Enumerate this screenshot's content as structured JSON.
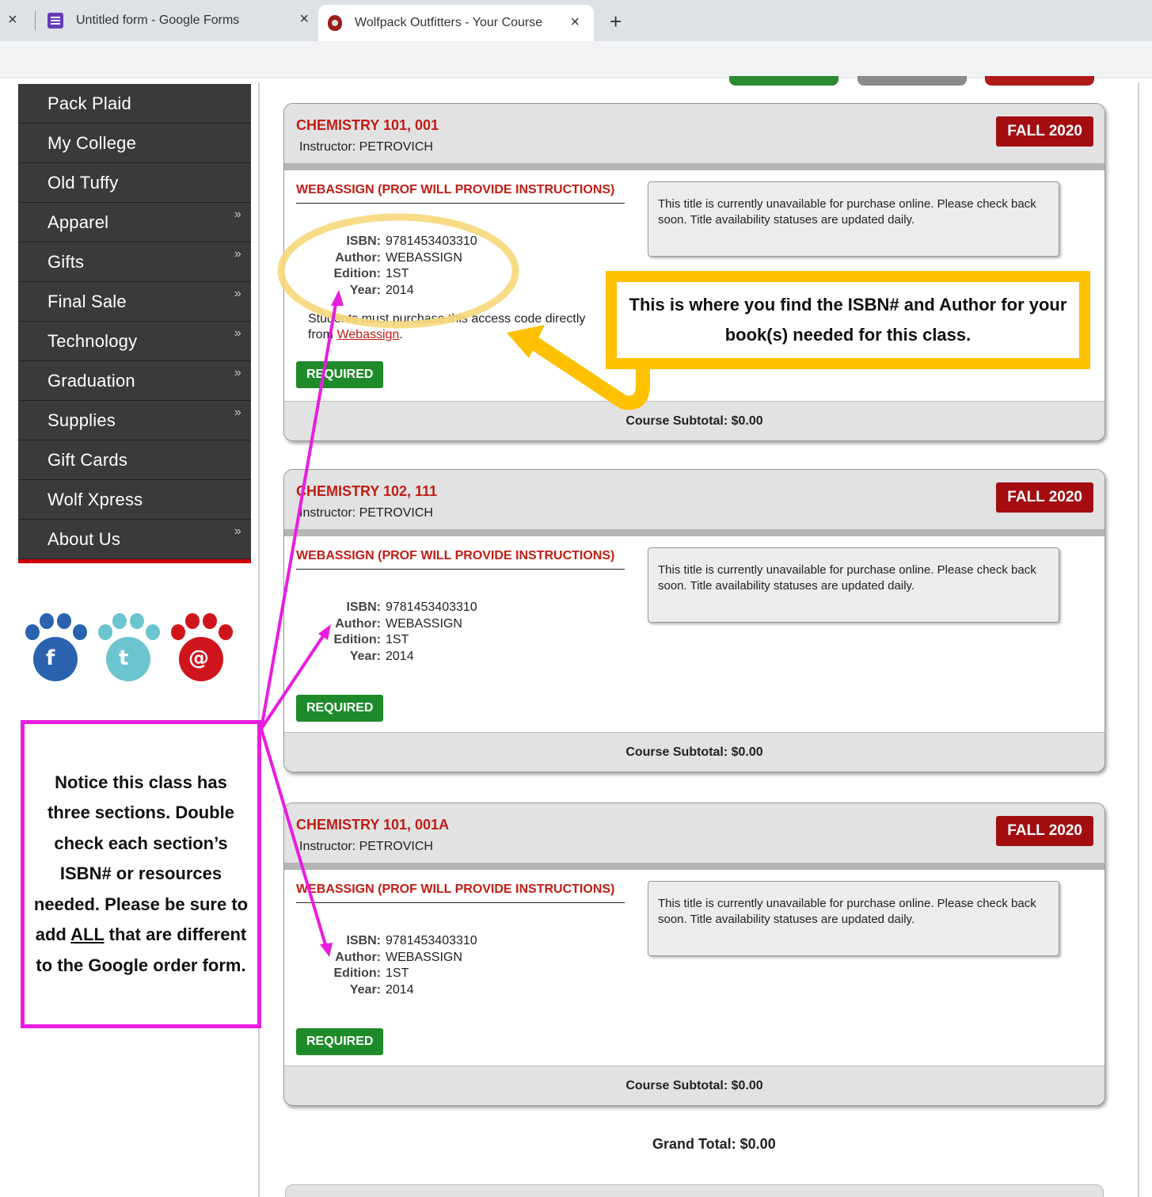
{
  "browser": {
    "tabs": [
      {
        "title": "Untitled form - Google Forms",
        "icon": "google-forms-icon"
      },
      {
        "title": "Wolfpack Outfitters - Your Course",
        "icon": "wolfpack-icon",
        "active": true
      }
    ],
    "new_tab_symbol": "+",
    "close_symbol": "×"
  },
  "sidebar": {
    "items": [
      {
        "label": "Pack Plaid",
        "submenu": false
      },
      {
        "label": "My College",
        "submenu": false
      },
      {
        "label": "Old Tuffy",
        "submenu": false
      },
      {
        "label": "Apparel",
        "submenu": true
      },
      {
        "label": "Gifts",
        "submenu": true
      },
      {
        "label": "Final Sale",
        "submenu": true
      },
      {
        "label": "Technology",
        "submenu": true
      },
      {
        "label": "Graduation",
        "submenu": true
      },
      {
        "label": "Supplies",
        "submenu": true
      },
      {
        "label": "Gift Cards",
        "submenu": false
      },
      {
        "label": "Wolf Xpress",
        "submenu": false
      },
      {
        "label": "About Us",
        "submenu": true
      }
    ],
    "chevron": "»",
    "social": [
      {
        "name": "facebook-paw-icon",
        "letter": "f",
        "color": "#2a62b0"
      },
      {
        "name": "twitter-paw-icon",
        "letter": "t",
        "color": "#6cc4cf"
      },
      {
        "name": "email-paw-icon",
        "letter": "@",
        "color": "#d0141b"
      }
    ]
  },
  "courses": [
    {
      "name": "CHEMISTRY 101, 001",
      "instructor": "Instructor: PETROVICH",
      "term": "FALL 2020",
      "book_title": "WEBASSIGN (PROF WILL PROVIDE INSTRUCTIONS)",
      "isbn_label": "ISBN:",
      "isbn": "9781453403310",
      "author_label": "Author:",
      "author": "WEBASSIGN",
      "edition_label": "Edition:",
      "edition": "1ST",
      "year_label": "Year:",
      "year": "2014",
      "note_text": "Students must purchase this access code directly from ",
      "note_link": "Webassign",
      "note_end": ".",
      "required": "REQUIRED",
      "availability": "This title is currently unavailable for purchase online. Please check back soon. Title availability statuses are updated daily.",
      "subtotal": "Course Subtotal: $0.00"
    },
    {
      "name": "CHEMISTRY 102, 111",
      "instructor": "Instructor: PETROVICH",
      "term": "FALL 2020",
      "book_title": "WEBASSIGN (PROF WILL PROVIDE INSTRUCTIONS)",
      "isbn_label": "ISBN:",
      "isbn": "9781453403310",
      "author_label": "Author:",
      "author": "WEBASSIGN",
      "edition_label": "Edition:",
      "edition": "1ST",
      "year_label": "Year:",
      "year": "2014",
      "required": "REQUIRED",
      "availability": "This title is currently unavailable for purchase online. Please check back soon. Title availability statuses are updated daily.",
      "subtotal": "Course Subtotal: $0.00"
    },
    {
      "name": "CHEMISTRY 101, 001A",
      "instructor": "Instructor: PETROVICH",
      "term": "FALL 2020",
      "book_title": "WEBASSIGN (PROF WILL PROVIDE INSTRUCTIONS)",
      "isbn_label": "ISBN:",
      "isbn": "9781453403310",
      "author_label": "Author:",
      "author": "WEBASSIGN",
      "edition_label": "Edition:",
      "edition": "1ST",
      "year_label": "Year:",
      "year": "2014",
      "required": "REQUIRED",
      "availability": "This title is currently unavailable for purchase online. Please check back soon. Title availability statuses are updated daily.",
      "subtotal": "Course Subtotal: $0.00"
    }
  ],
  "grand_total": "Grand Total:  $0.00",
  "annotations": {
    "yellow_callout": "This is where you find the ISBN# and Author for your book(s) needed for this class.",
    "pink_callout_pre": "Notice this class has three sections. Double check each section’s ISBN# or resources needed. Please be sure to add ",
    "pink_callout_emph": "ALL",
    "pink_callout_post": " that are different to the Google order form.",
    "colors": {
      "yellow": "#ffc000",
      "pink": "#e81de0"
    }
  },
  "colors": {
    "accent_red": "#c11d14",
    "term_badge": "#a30d10",
    "required_green": "#1f8a2a",
    "nav_bg": "#3a3a3a"
  }
}
